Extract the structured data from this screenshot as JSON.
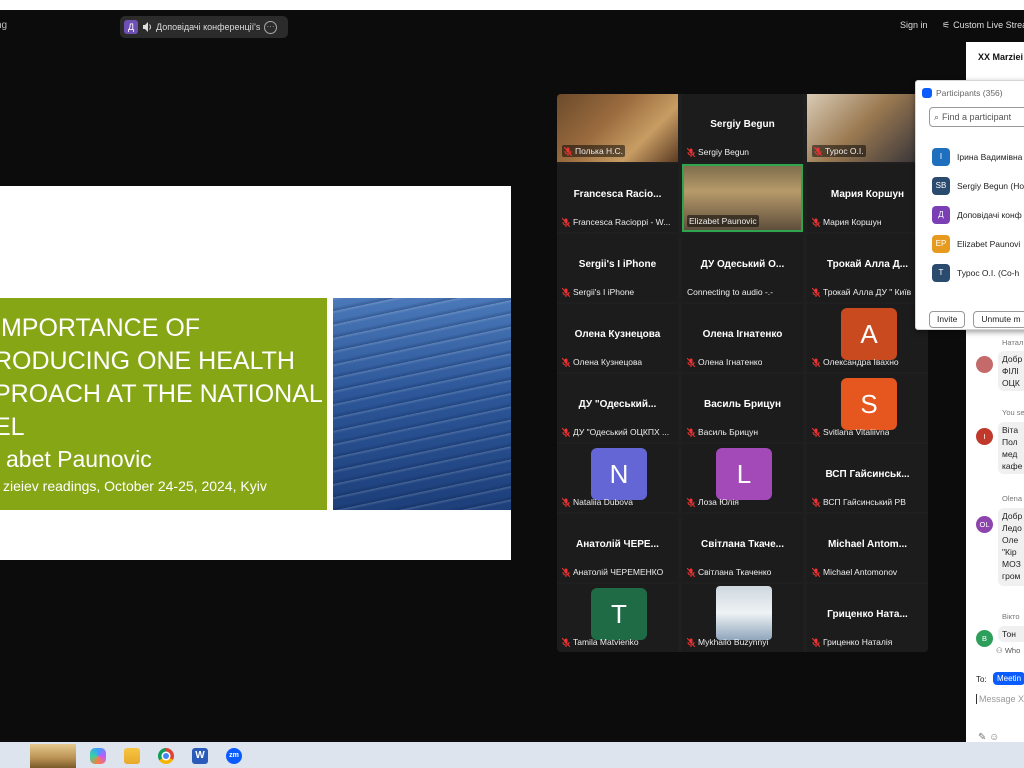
{
  "topbar": {
    "app_name_fragment": "ng",
    "speaker_initial": "Д",
    "speaker_name": "Доповідачі конференції's s",
    "sign_in": "Sign in",
    "live_stream": "Custom Live Stream"
  },
  "slide": {
    "title": "IMPORTANCE OF\nRODUCING ONE HEALTH\nPROACH AT THE NATIONAL\nEL",
    "author": "abet Paunovic",
    "subtitle": "zieiev readings, October 24-25, 2024, Kyiv"
  },
  "gallery": {
    "tiles": [
      {
        "label": "Полька Н.С."
      },
      {
        "name": "Sergiy Begun",
        "label": "Sergiy Begun"
      },
      {
        "label": "Турос О.І."
      },
      {
        "name": "Francesca Racio...",
        "label": "Francesca Racioppi - W..."
      },
      {
        "label": "Elizabet Paunovic"
      },
      {
        "name": "Мария Коршун",
        "label": "Мария Коршун"
      },
      {
        "name": "Sergii's I iPhone",
        "label": "Sergii's I iPhone"
      },
      {
        "name": "ДУ Одеський О...",
        "label": "Connecting to audio -.-"
      },
      {
        "name": "Трокай Алла Д...",
        "label": "Трокай Алла ДУ \" Київ"
      },
      {
        "name": "Олена Кузнецова",
        "label": "Олена Кузнецова"
      },
      {
        "name": "Олена Ігнатенко",
        "label": "Олена Ігнатенко"
      },
      {
        "initial": "A",
        "color": "#c94a1f",
        "label": "Олександра Івахно"
      },
      {
        "name": "ДУ \"Одеський...",
        "label": "ДУ \"Одеський ОЦКПХ ..."
      },
      {
        "name": "Василь Брицун",
        "label": "Василь Брицун"
      },
      {
        "initial": "S",
        "color": "#e5571f",
        "label": "Svitlana Vitaliivna"
      },
      {
        "initial": "N",
        "color": "#6566d6",
        "label": "Nataliia Dubova"
      },
      {
        "initial": "L",
        "color": "#a34ab8",
        "label": "Лоза Юлія"
      },
      {
        "name": "ВСП Гайсинськ...",
        "label": "ВСП Гайсинський РВ"
      },
      {
        "name": "Анатолій ЧЕРЕ...",
        "label": "Анатолій ЧЕРЕМЕНКО"
      },
      {
        "name": "Світлана Ткаче...",
        "label": "Світлана Ткаченко"
      },
      {
        "name": "Michael Antom...",
        "label": "Michael Antomonov"
      },
      {
        "initial": "T",
        "color": "#1e6b45",
        "label": "Tamila Matvienko"
      },
      {
        "label": "Mykhailo Buzynnyi"
      },
      {
        "name": "Гриценко Ната...",
        "label": "Гриценко Наталія"
      }
    ]
  },
  "participants": {
    "header": "Participants (356)",
    "search_placeholder": "Find a participant",
    "rows": [
      {
        "initial": "I",
        "color": "#1f6fbf",
        "name": "Ірина Вадимівна"
      },
      {
        "initial": "SB",
        "color": "#2a4a6e",
        "name": "Sergiy Begun (Ho"
      },
      {
        "initial": "Д",
        "color": "#7b3fb5",
        "name": "Доповідачі конф"
      },
      {
        "initial": "EP",
        "color": "#e69a1f",
        "name": "Elizabet Paunovi"
      },
      {
        "initial": "T",
        "color": "#2a4a6e",
        "name": "Турос О.І. (Co-h"
      }
    ],
    "invite": "Invite",
    "unmute": "Unmute m"
  },
  "chat": {
    "title": "XX Marziei",
    "messages": [
      {
        "sender": "Натал",
        "initial": "",
        "color": "#c46a6a",
        "text": "Добр\nФІЛІ\nОЦК"
      },
      {
        "sender": "You se",
        "initial": "I",
        "color": "#c0392b",
        "text": "Віта\nПол\nмед\nкафе"
      },
      {
        "sender": "Olena",
        "initial": "OL",
        "color": "#8e44ad",
        "text": "Добр\nЛедо\nОле\n\"Кір\nМОЗ\nгром"
      },
      {
        "sender": "Вікто",
        "initial": "B",
        "color": "#2e9e5b",
        "text": "Тон"
      }
    ],
    "who_can_see": "Who",
    "to_label": "To:",
    "to_value": "Meetin",
    "message_placeholder": "Message X"
  },
  "taskbar": {
    "items": [
      "wallpaper-thumbnail",
      "copilot",
      "file-explorer",
      "chrome",
      "word",
      "zoom"
    ],
    "word_glyph": "W",
    "zoom_glyph": "zm"
  }
}
